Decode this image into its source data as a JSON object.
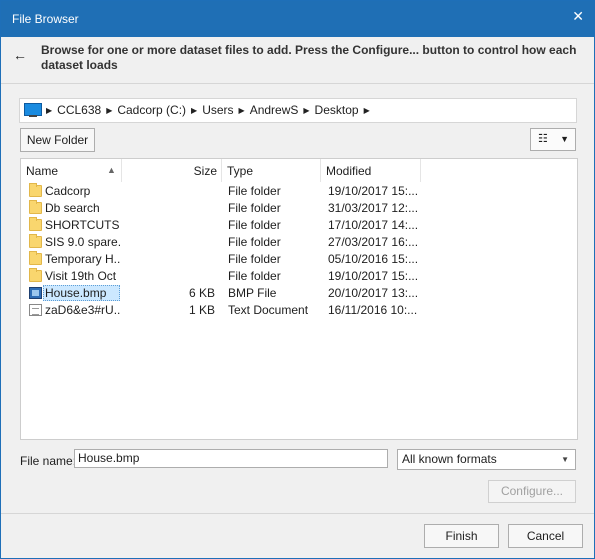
{
  "window": {
    "title": "File Browser",
    "close_glyph": "✕"
  },
  "header": {
    "back_glyph": "←",
    "instructions": "Browse for one or more dataset files to add. Press the Configure... button to control how each dataset loads"
  },
  "breadcrumbs": [
    "CCL638",
    "Cadcorp (C:)",
    "Users",
    "AndrewS",
    "Desktop"
  ],
  "toolbar": {
    "new_folder_label": "New Folder"
  },
  "columns": {
    "name": "Name",
    "size": "Size",
    "type": "Type",
    "modified": "Modified"
  },
  "files": [
    {
      "name": "Cadcorp",
      "size": "",
      "type": "File folder",
      "modified": "19/10/2017 15:...",
      "icon": "folder"
    },
    {
      "name": "Db search",
      "size": "",
      "type": "File folder",
      "modified": "31/03/2017 12:...",
      "icon": "folder"
    },
    {
      "name": "SHORTCUTS",
      "size": "",
      "type": "File folder",
      "modified": "17/10/2017 14:...",
      "icon": "folder"
    },
    {
      "name": "SIS 9.0 spare...",
      "size": "",
      "type": "File folder",
      "modified": "27/03/2017 16:...",
      "icon": "folder"
    },
    {
      "name": "Temporary H...",
      "size": "",
      "type": "File folder",
      "modified": "05/10/2016 15:...",
      "icon": "folder"
    },
    {
      "name": "Visit 19th Oct",
      "size": "",
      "type": "File folder",
      "modified": "19/10/2017 15:...",
      "icon": "folder"
    },
    {
      "name": "House.bmp",
      "size": "6 KB",
      "type": "BMP File",
      "modified": "20/10/2017 13:...",
      "icon": "bmp"
    },
    {
      "name": "zaD6&e3#rU...",
      "size": "1 KB",
      "type": "Text Document",
      "modified": "16/11/2016 10:...",
      "icon": "text"
    }
  ],
  "filename": {
    "label": "File name:",
    "value": "House.bmp"
  },
  "format": {
    "selected": "All known formats"
  },
  "buttons": {
    "configure": "Configure...",
    "finish": "Finish",
    "cancel": "Cancel"
  }
}
